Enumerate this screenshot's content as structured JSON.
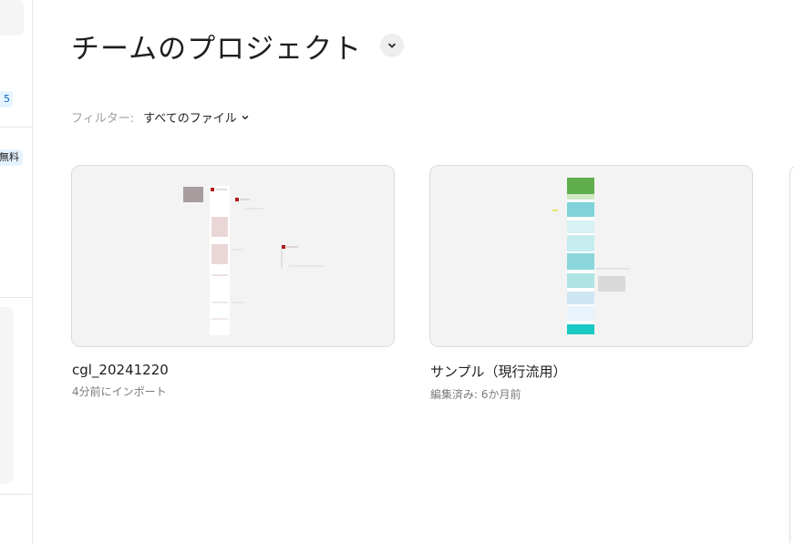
{
  "sidebar": {
    "badge_number": "5",
    "free_badge": "無料"
  },
  "header": {
    "title": "チームのプロジェクト"
  },
  "filter": {
    "label": "フィルター:",
    "value": "すべてのファイル"
  },
  "files": [
    {
      "name": "cgl_20241220",
      "meta": "4分前にインポート"
    },
    {
      "name": "サンプル（現行流用）",
      "meta": "編集済み: 6か月前"
    }
  ],
  "colors": {
    "thumb_bg": "#f3f3f3",
    "badge_bg": "#e5f4ff",
    "text_primary": "#1e1e1e",
    "text_secondary": "#7a7a7a"
  },
  "icons": [
    "chevron-down-icon"
  ]
}
